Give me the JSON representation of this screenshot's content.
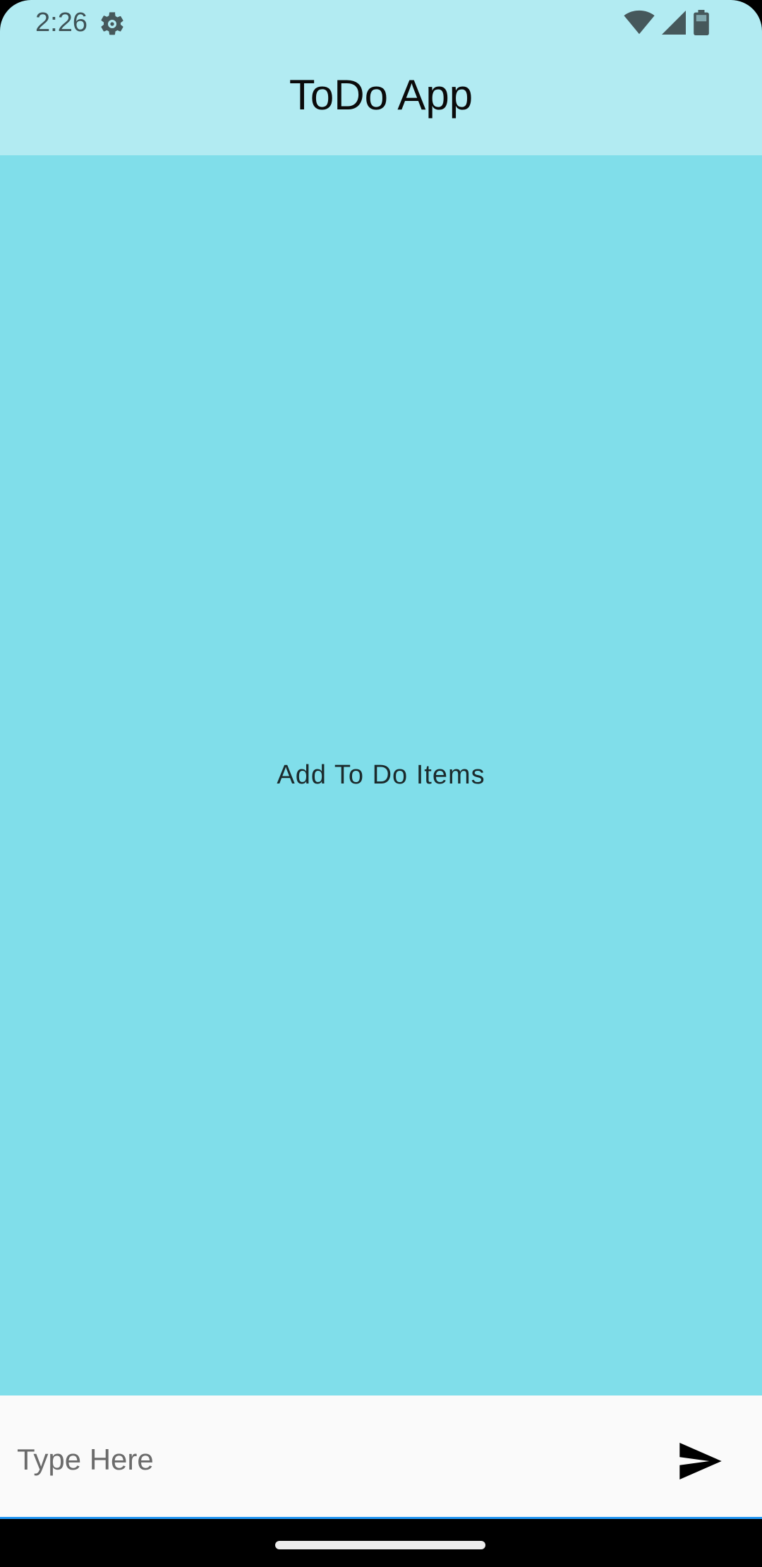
{
  "status_bar": {
    "time": "2:26",
    "icons": [
      "gear-icon",
      "wifi-icon",
      "signal-icon",
      "battery-icon"
    ]
  },
  "app_bar": {
    "title": "ToDo App"
  },
  "main": {
    "empty_message": "Add To Do Items"
  },
  "input_bar": {
    "value": "",
    "placeholder": "Type Here",
    "send_icon": "send-icon"
  },
  "colors": {
    "app_bar": "#B2EBF2",
    "content_background": "#80DEEA",
    "input_background": "#FAFAFA",
    "input_underline": "#2196F3"
  }
}
